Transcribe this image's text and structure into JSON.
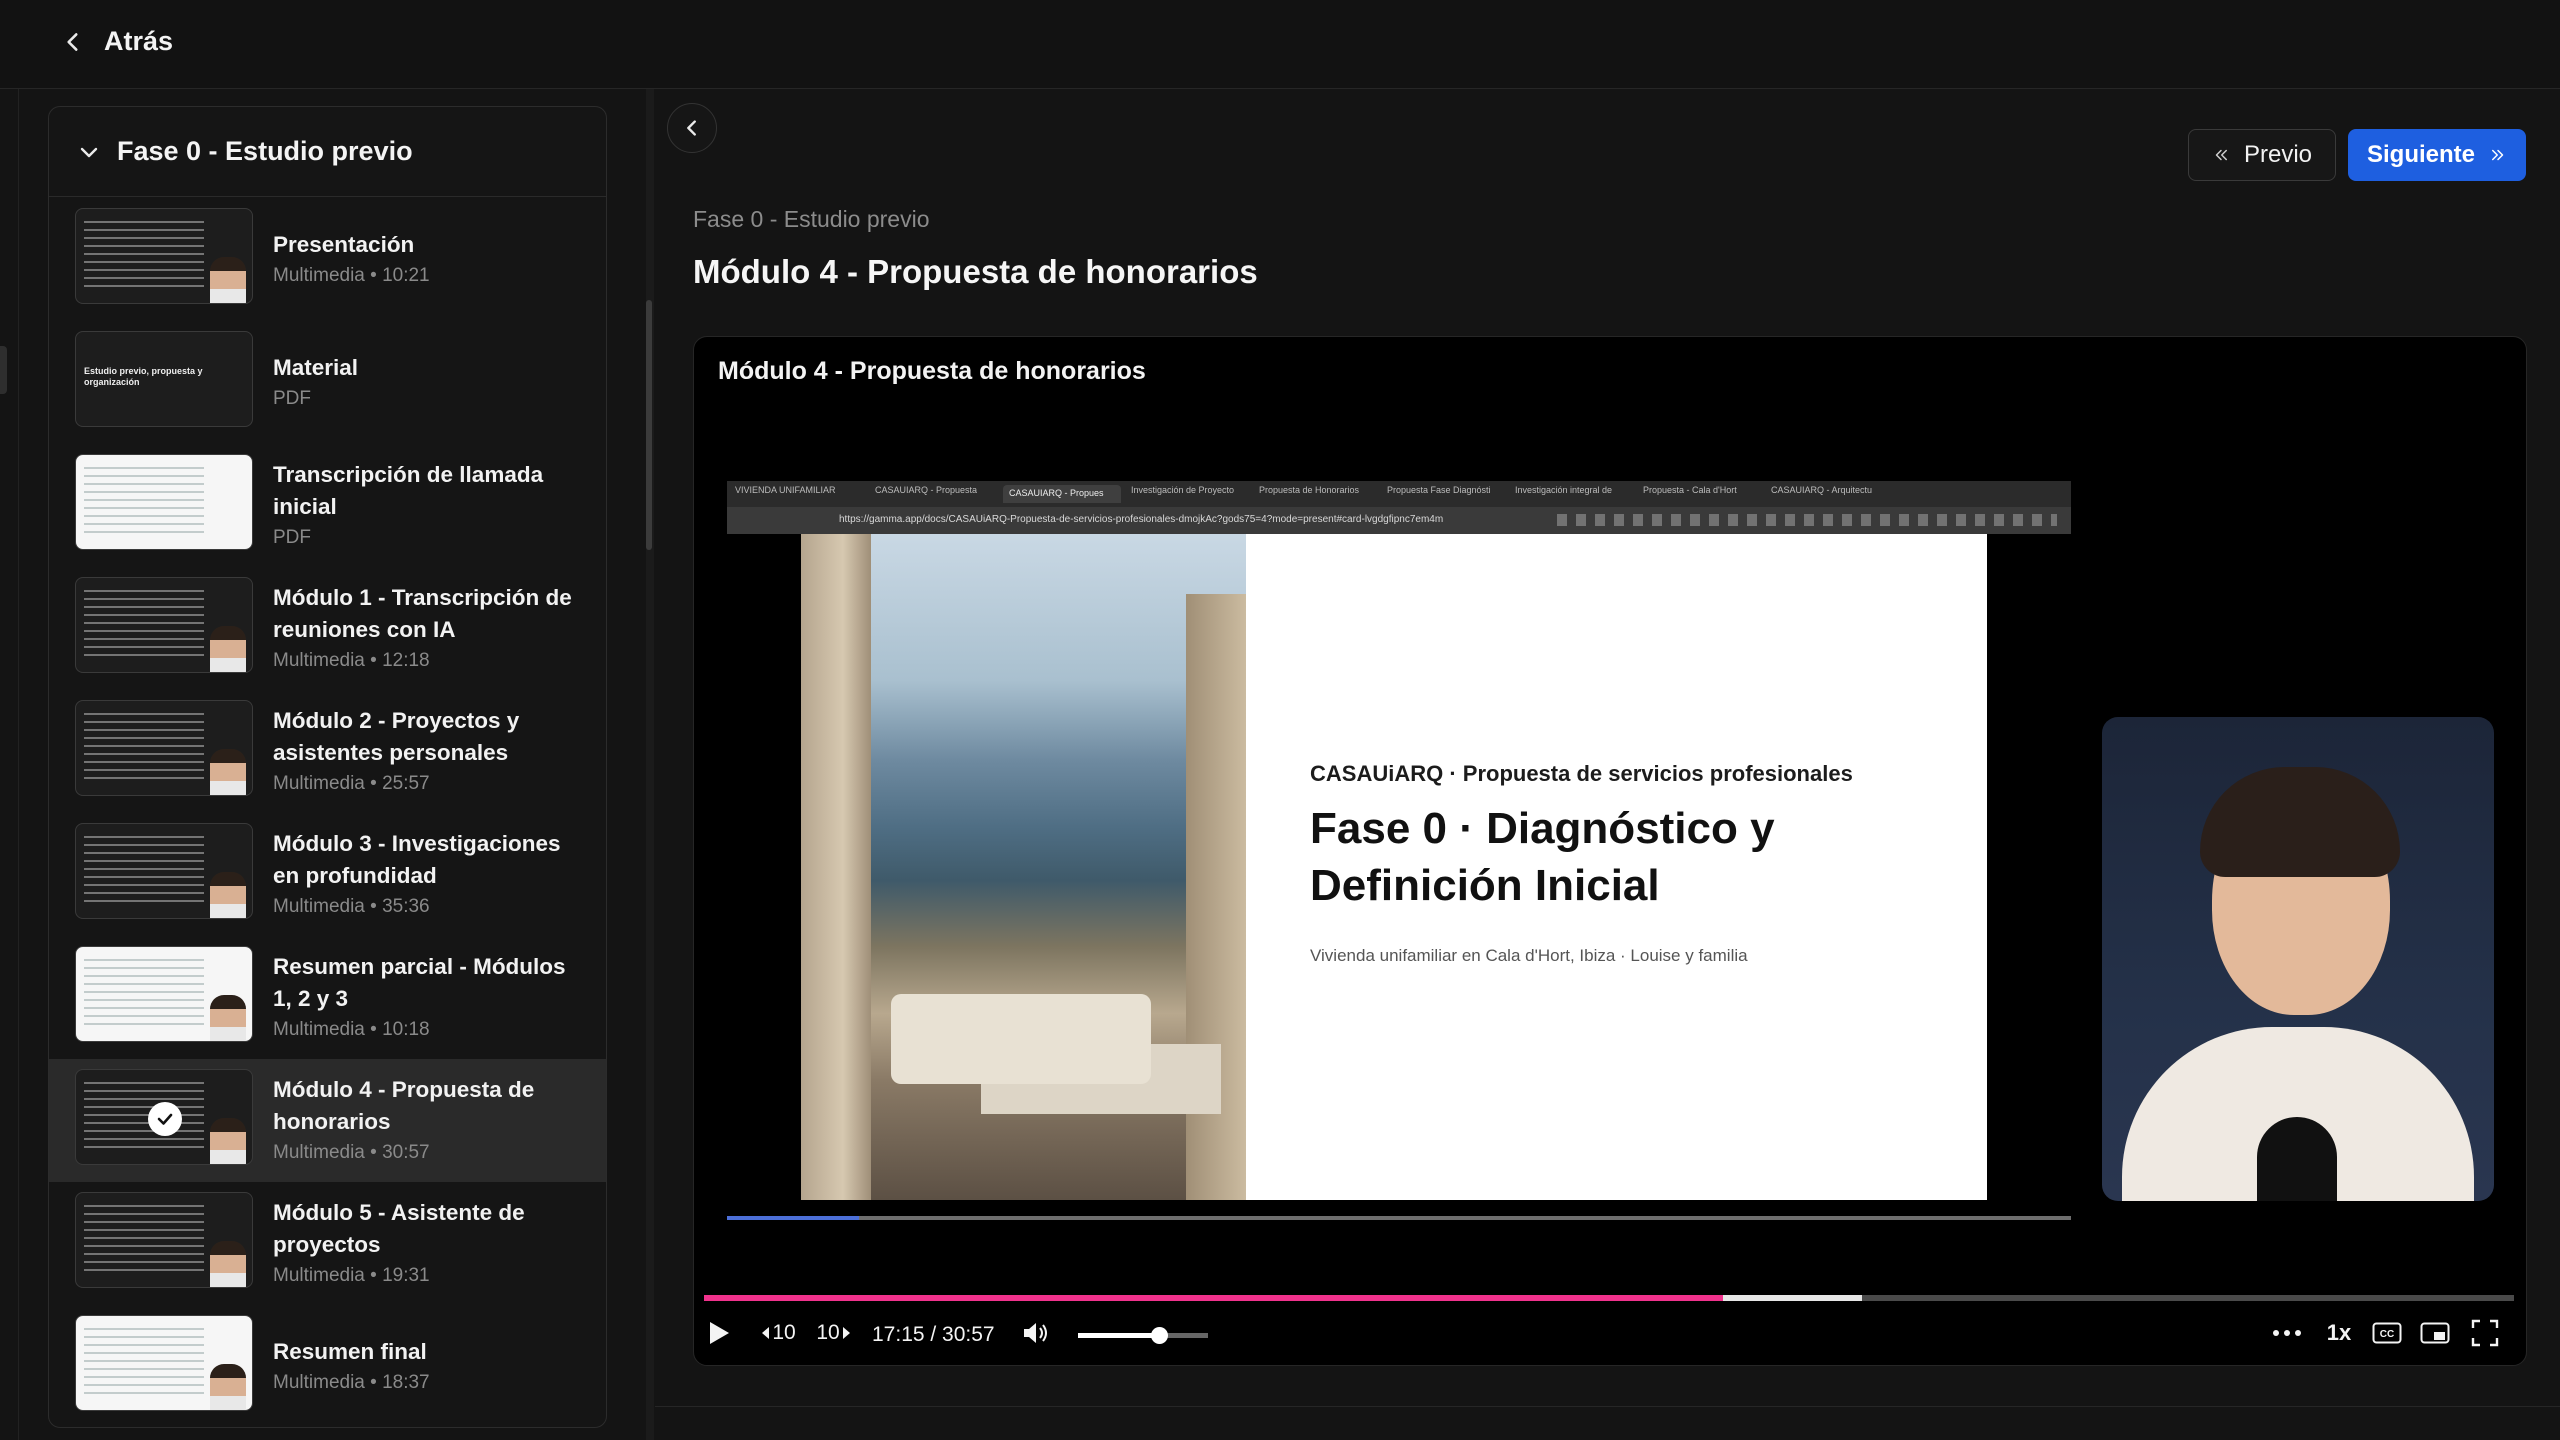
{
  "header": {
    "back_label": "Atrás"
  },
  "sidebar": {
    "section_title": "Fase 0 - Estudio previo",
    "items": [
      {
        "title": "Presentación",
        "subtitle": "Multimedia • 10:21",
        "thumb": "dark",
        "active": false
      },
      {
        "title": "Material",
        "subtitle": "PDF",
        "thumb": "dark",
        "active": false
      },
      {
        "title": "Transcripción de llamada inicial",
        "subtitle": "PDF",
        "thumb": "light",
        "active": false
      },
      {
        "title": "Módulo 1 - Transcripción de reuniones con IA",
        "subtitle": "Multimedia • 12:18",
        "thumb": "dark",
        "active": false
      },
      {
        "title": "Módulo 2 - Proyectos y asistentes personales",
        "subtitle": "Multimedia • 25:57",
        "thumb": "dark",
        "active": false
      },
      {
        "title": "Módulo 3 - Investigaciones en profundidad",
        "subtitle": "Multimedia • 35:36",
        "thumb": "dark",
        "active": false
      },
      {
        "title": "Resumen parcial - Módulos 1, 2 y 3",
        "subtitle": "Multimedia • 10:18",
        "thumb": "light",
        "active": false
      },
      {
        "title": "Módulo 4 - Propuesta de honorarios",
        "subtitle": "Multimedia • 30:57",
        "thumb": "dark",
        "active": true
      },
      {
        "title": "Módulo 5 - Asistente de proyectos",
        "subtitle": "Multimedia • 19:31",
        "thumb": "dark",
        "active": false
      },
      {
        "title": "Resumen final",
        "subtitle": "Multimedia • 18:37",
        "thumb": "light",
        "active": false
      }
    ],
    "thumb_texts": {
      "material": "Estudio previo, propuesta y organización"
    }
  },
  "nav": {
    "prev_label": "Previo",
    "next_label": "Siguiente"
  },
  "main": {
    "breadcrumb": "Fase 0 - Estudio previo",
    "title": "Módulo 4 - Propuesta de honorarios"
  },
  "player": {
    "video_title": "Módulo 4 - Propuesta de honorarios",
    "time_display": "17:15 / 30:57",
    "played_fraction": 0.563,
    "buffered_fraction": 0.64,
    "volume_fraction": 0.62,
    "speed_label": "1x",
    "skip_back_label": "10",
    "skip_forward_label": "10",
    "cc_label": "CC"
  },
  "video_content": {
    "browser_tabs": [
      "VIVIENDA UNIFAMILIAR",
      "CASAUIARQ - Propuesta",
      "CASAUIARQ - Propues",
      "Investigación de Proyecto",
      "Propuesta de Honorarios",
      "Propuesta Fase Diagnósti",
      "Investigación integral de",
      "Propuesta - Cala d'Hort",
      "CASAUIARQ - Arquitectu"
    ],
    "url": "https://gamma.app/docs/CASAUiARQ-Propuesta-de-servicios-profesionales-dmojkAc?gods75=4?mode=present#card-lvgdgfipnc7em4m",
    "slide_kicker": "CASAUiARQ · Propuesta de servicios profesionales",
    "slide_heading": "Fase 0 · Diagnóstico y Definición Inicial",
    "slide_sub": "Vivienda unifamiliar en Cala d'Hort, Ibiza · Louise y familia",
    "video_progress_fraction": 0.098
  },
  "colors": {
    "accent": "#1e5fe0",
    "progress": "#f0328c",
    "background": "#141414"
  }
}
